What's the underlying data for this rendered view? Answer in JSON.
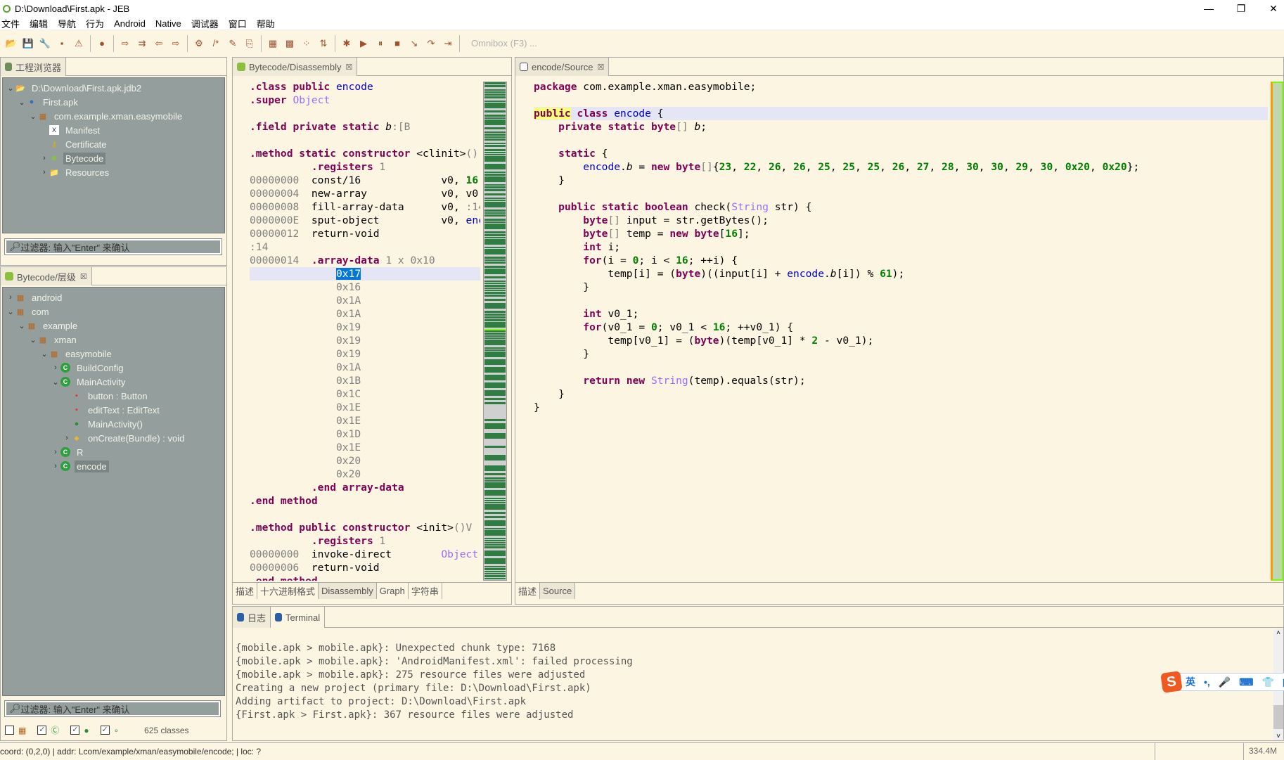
{
  "window": {
    "title": "D:\\Download\\First.apk - JEB",
    "minimize": "—",
    "restore": "❐",
    "close": "✕"
  },
  "menu": [
    "文件",
    "编辑",
    "导航",
    "行为",
    "Android",
    "Native",
    "调试器",
    "窗口",
    "帮助"
  ],
  "toolbar": {
    "icons": [
      "open-folder-icon",
      "save-icon",
      "wrench-icon",
      "stamp-icon",
      "warning-icon",
      "|",
      "globe-icon",
      "|",
      "jump-icon",
      "navigate-icon",
      "back-icon",
      "forward-icon",
      "|",
      "decompile-icon",
      "comment-icon",
      "rename-icon",
      "export-icon",
      "|",
      "package-icon",
      "classes-icon",
      "graph-icon",
      "sort-icon",
      "|",
      "debug-bug-icon",
      "run-icon",
      "pause-icon",
      "stop-icon",
      "step-into-icon",
      "step-over-icon",
      "step-out-icon",
      "|"
    ],
    "glyphs": [
      "📂",
      "💾",
      "🔧",
      "▪",
      "⚠",
      "",
      "●",
      "",
      "⇨",
      "⇉",
      "⇦",
      "⇨",
      "",
      "⚙",
      "/*",
      "✎",
      "⎘",
      "",
      "▦",
      "▩",
      "⁘",
      "⇅",
      "",
      "✱",
      "▶",
      "⏸",
      "■",
      "↘",
      "↷",
      "⇥",
      ""
    ],
    "omnibox": "Omnibox (F3) ..."
  },
  "project_explorer": {
    "tab": "工程浏览器",
    "items": [
      {
        "label": "D:\\Download\\First.apk.jdb2",
        "icon": "folder-open-icon",
        "depth": 0,
        "arrow": "v"
      },
      {
        "label": "First.apk",
        "icon": "apk-icon",
        "depth": 1,
        "arrow": "v"
      },
      {
        "label": "com.example.xman.easymobile",
        "icon": "package-icon",
        "depth": 2,
        "arrow": "v"
      },
      {
        "label": "Manifest",
        "icon": "xml-icon",
        "depth": 3,
        "arrow": ""
      },
      {
        "label": "Certificate",
        "icon": "key-icon",
        "depth": 3,
        "arrow": ""
      },
      {
        "label": "Bytecode",
        "icon": "android-icon",
        "depth": 3,
        "arrow": ">",
        "selected": true
      },
      {
        "label": "Resources",
        "icon": "folder-icon",
        "depth": 3,
        "arrow": ">"
      }
    ],
    "filter": "过滤器: 输入\"Enter\" 来确认"
  },
  "hierarchy": {
    "tab": "Bytecode/层级",
    "items": [
      {
        "label": "android",
        "icon": "package-icon",
        "depth": 0,
        "arrow": ">"
      },
      {
        "label": "com",
        "icon": "package-icon",
        "depth": 0,
        "arrow": "v"
      },
      {
        "label": "example",
        "icon": "package-icon",
        "depth": 1,
        "arrow": "v"
      },
      {
        "label": "xman",
        "icon": "package-icon",
        "depth": 2,
        "arrow": "v"
      },
      {
        "label": "easymobile",
        "icon": "package-icon",
        "depth": 3,
        "arrow": "v"
      },
      {
        "label": "BuildConfig",
        "icon": "class-icon",
        "depth": 4,
        "arrow": ">"
      },
      {
        "label": "MainActivity",
        "icon": "class-icon",
        "depth": 4,
        "arrow": "v"
      },
      {
        "label": "button : Button",
        "icon": "field-icon",
        "depth": 5,
        "arrow": ""
      },
      {
        "label": "editText : EditText",
        "icon": "field-icon",
        "depth": 5,
        "arrow": ""
      },
      {
        "label": "MainActivity()",
        "icon": "constructor-icon",
        "depth": 5,
        "arrow": ""
      },
      {
        "label": "onCreate(Bundle) : void",
        "icon": "method-icon",
        "depth": 5,
        "arrow": ">"
      },
      {
        "label": "R",
        "icon": "class-icon",
        "depth": 4,
        "arrow": ">"
      },
      {
        "label": "encode",
        "icon": "class-icon",
        "depth": 4,
        "arrow": ">",
        "selected": true
      }
    ],
    "filter": "过滤器: 输入\"Enter\" 来确认",
    "classes": "625 classes",
    "checks": [
      false,
      true,
      true,
      true
    ]
  },
  "disassembly": {
    "tab": "Bytecode/Disassembly",
    "bottom_tabs": [
      "描述",
      "十六进制格式",
      "Disassembly",
      "Graph",
      "字符串"
    ],
    "active_bottom": 2,
    "lines": [
      [
        [
          "k",
          ".class public "
        ],
        [
          "b",
          "encode"
        ]
      ],
      [
        [
          "k",
          ".super "
        ],
        [
          "o",
          "Object"
        ]
      ],
      [],
      [
        [
          "k",
          ".field private static "
        ],
        [
          "i",
          "b"
        ],
        [
          "g",
          ":[B"
        ]
      ],
      [],
      [
        [
          "k",
          ".method static constructor "
        ],
        [
          "t",
          "<clinit>"
        ],
        [
          "g",
          "()"
        ]
      ],
      [
        [
          "t",
          "          "
        ],
        [
          "k",
          ".registers "
        ],
        [
          "g",
          "1"
        ]
      ],
      [
        [
          "g",
          "00000000  "
        ],
        [
          "t",
          "const/16             v0, "
        ],
        [
          "n",
          "16"
        ]
      ],
      [
        [
          "g",
          "00000004  "
        ],
        [
          "t",
          "new-array            v0, v0,"
        ]
      ],
      [
        [
          "g",
          "00000008  "
        ],
        [
          "t",
          "fill-array-data      v0, "
        ],
        [
          "g",
          ":14"
        ]
      ],
      [
        [
          "g",
          "0000000E  "
        ],
        [
          "t",
          "sput-object          v0, "
        ],
        [
          "b",
          "encode"
        ]
      ],
      [
        [
          "g",
          "00000012  "
        ],
        [
          "t",
          "return-void"
        ]
      ],
      [
        [
          "g",
          ":14"
        ]
      ],
      [
        [
          "g",
          "00000014  "
        ],
        [
          "k",
          ".array-data "
        ],
        [
          "g",
          "1 x 0x10"
        ]
      ],
      [
        [
          "t",
          "              "
        ],
        [
          "sel",
          "0x17"
        ]
      ],
      [
        [
          "g",
          "              0x16"
        ]
      ],
      [
        [
          "g",
          "              0x1A"
        ]
      ],
      [
        [
          "g",
          "              0x1A"
        ]
      ],
      [
        [
          "g",
          "              0x19"
        ]
      ],
      [
        [
          "g",
          "              0x19"
        ]
      ],
      [
        [
          "g",
          "              0x19"
        ]
      ],
      [
        [
          "g",
          "              0x1A"
        ]
      ],
      [
        [
          "g",
          "              0x1B"
        ]
      ],
      [
        [
          "g",
          "              0x1C"
        ]
      ],
      [
        [
          "g",
          "              0x1E"
        ]
      ],
      [
        [
          "g",
          "              0x1E"
        ]
      ],
      [
        [
          "g",
          "              0x1D"
        ]
      ],
      [
        [
          "g",
          "              0x1E"
        ]
      ],
      [
        [
          "g",
          "              0x20"
        ]
      ],
      [
        [
          "g",
          "              0x20"
        ]
      ],
      [
        [
          "t",
          "          "
        ],
        [
          "k",
          ".end array-data"
        ]
      ],
      [
        [
          "k",
          ".end method"
        ]
      ],
      [],
      [
        [
          "k",
          ".method public constructor "
        ],
        [
          "t",
          "<init>"
        ],
        [
          "g",
          "()V"
        ]
      ],
      [
        [
          "t",
          "          "
        ],
        [
          "k",
          ".registers "
        ],
        [
          "g",
          "1"
        ]
      ],
      [
        [
          "g",
          "00000000  "
        ],
        [
          "t",
          "invoke-direct        "
        ],
        [
          "o",
          "Object-"
        ]
      ],
      [
        [
          "g",
          "00000006  "
        ],
        [
          "t",
          "return-void"
        ]
      ],
      [
        [
          "k",
          ".end method"
        ]
      ]
    ]
  },
  "source": {
    "tab": "encode/Source",
    "bottom_tabs": [
      "描述",
      "Source"
    ],
    "active_bottom": 1,
    "lines": [
      [
        [
          "k",
          "package "
        ],
        [
          "t",
          "com.example.xman.easymobile;"
        ]
      ],
      [],
      [
        [
          "hl",
          "public"
        ],
        [
          "k",
          " class "
        ],
        [
          "b",
          "encode"
        ],
        [
          "t",
          " {"
        ]
      ],
      [
        [
          "t",
          "    "
        ],
        [
          "k",
          "private static byte"
        ],
        [
          "g",
          "[]"
        ],
        [
          "t",
          " "
        ],
        [
          "i",
          "b"
        ],
        [
          "t",
          ";"
        ]
      ],
      [],
      [
        [
          "t",
          "    "
        ],
        [
          "k",
          "static"
        ],
        [
          "t",
          " {"
        ]
      ],
      [
        [
          "t",
          "        "
        ],
        [
          "b",
          "encode"
        ],
        [
          "t",
          "."
        ],
        [
          "i",
          "b"
        ],
        [
          "t",
          " = "
        ],
        [
          "k",
          "new byte"
        ],
        [
          "g",
          "[]"
        ],
        [
          "t",
          "{"
        ],
        [
          "n",
          "23"
        ],
        [
          "t",
          ", "
        ],
        [
          "n",
          "22"
        ],
        [
          "t",
          ", "
        ],
        [
          "n",
          "26"
        ],
        [
          "t",
          ", "
        ],
        [
          "n",
          "26"
        ],
        [
          "t",
          ", "
        ],
        [
          "n",
          "25"
        ],
        [
          "t",
          ", "
        ],
        [
          "n",
          "25"
        ],
        [
          "t",
          ", "
        ],
        [
          "n",
          "25"
        ],
        [
          "t",
          ", "
        ],
        [
          "n",
          "26"
        ],
        [
          "t",
          ", "
        ],
        [
          "n",
          "27"
        ],
        [
          "t",
          ", "
        ],
        [
          "n",
          "28"
        ],
        [
          "t",
          ", "
        ],
        [
          "n",
          "30"
        ],
        [
          "t",
          ", "
        ],
        [
          "n",
          "30"
        ],
        [
          "t",
          ", "
        ],
        [
          "n",
          "29"
        ],
        [
          "t",
          ", "
        ],
        [
          "n",
          "30"
        ],
        [
          "t",
          ", "
        ],
        [
          "n",
          "0x20"
        ],
        [
          "t",
          ", "
        ],
        [
          "n",
          "0x20"
        ],
        [
          "t",
          "};"
        ]
      ],
      [
        [
          "t",
          "    }"
        ]
      ],
      [],
      [
        [
          "t",
          "    "
        ],
        [
          "k",
          "public static boolean"
        ],
        [
          "t",
          " check("
        ],
        [
          "o",
          "String"
        ],
        [
          "t",
          " str) {"
        ]
      ],
      [
        [
          "t",
          "        "
        ],
        [
          "k",
          "byte"
        ],
        [
          "g",
          "[]"
        ],
        [
          "t",
          " input = str.getBytes();"
        ]
      ],
      [
        [
          "t",
          "        "
        ],
        [
          "k",
          "byte"
        ],
        [
          "g",
          "[]"
        ],
        [
          "t",
          " temp = "
        ],
        [
          "k",
          "new byte"
        ],
        [
          "t",
          "["
        ],
        [
          "n",
          "16"
        ],
        [
          "t",
          "];"
        ]
      ],
      [
        [
          "t",
          "        "
        ],
        [
          "k",
          "int"
        ],
        [
          "t",
          " i;"
        ]
      ],
      [
        [
          "t",
          "        "
        ],
        [
          "k",
          "for"
        ],
        [
          "t",
          "(i = "
        ],
        [
          "n",
          "0"
        ],
        [
          "t",
          "; i < "
        ],
        [
          "n",
          "16"
        ],
        [
          "t",
          "; ++i) {"
        ]
      ],
      [
        [
          "t",
          "            temp[i] = ("
        ],
        [
          "k",
          "byte"
        ],
        [
          "t",
          ")((input[i] + "
        ],
        [
          "b",
          "encode"
        ],
        [
          "t",
          "."
        ],
        [
          "i",
          "b"
        ],
        [
          "t",
          "[i]) % "
        ],
        [
          "n",
          "61"
        ],
        [
          "t",
          ");"
        ]
      ],
      [
        [
          "t",
          "        }"
        ]
      ],
      [],
      [
        [
          "t",
          "        "
        ],
        [
          "k",
          "int"
        ],
        [
          "t",
          " v0_1;"
        ]
      ],
      [
        [
          "t",
          "        "
        ],
        [
          "k",
          "for"
        ],
        [
          "t",
          "(v0_1 = "
        ],
        [
          "n",
          "0"
        ],
        [
          "t",
          "; v0_1 < "
        ],
        [
          "n",
          "16"
        ],
        [
          "t",
          "; ++v0_1) {"
        ]
      ],
      [
        [
          "t",
          "            temp[v0_1] = ("
        ],
        [
          "k",
          "byte"
        ],
        [
          "t",
          ")(temp[v0_1] * "
        ],
        [
          "n",
          "2"
        ],
        [
          "t",
          " - v0_1);"
        ]
      ],
      [
        [
          "t",
          "        }"
        ]
      ],
      [],
      [
        [
          "t",
          "        "
        ],
        [
          "k",
          "return new "
        ],
        [
          "o",
          "String"
        ],
        [
          "t",
          "(temp).equals(str);"
        ]
      ],
      [
        [
          "t",
          "    }"
        ]
      ],
      [
        [
          "t",
          "}"
        ]
      ]
    ]
  },
  "console": {
    "tabs": [
      "日志",
      "Terminal"
    ],
    "lines": [
      "{mobile.apk > mobile.apk}: Unexpected chunk type: 7168",
      "{mobile.apk > mobile.apk}: 'AndroidManifest.xml': failed processing",
      "{mobile.apk > mobile.apk}: 275 resource files were adjusted",
      "Creating a new project (primary file: D:\\Download\\First.apk)",
      "Adding artifact to project: D:\\Download\\First.apk",
      "{First.apk > First.apk}: 367 resource files were adjusted"
    ]
  },
  "ime": {
    "logo": "S",
    "items": [
      "英",
      "•,",
      "🎤",
      "⌨",
      "👕",
      "▦"
    ]
  },
  "statusbar": {
    "text": "coord: (0,2,0) | addr: Lcom/example/xman/easymobile/encode; | loc: ?",
    "memory": "334.4M"
  },
  "colors": {
    "background": "#fcf5e2",
    "tree": "#949f9d",
    "keyword": "#7f0055",
    "number": "#008000",
    "type": "#9a6cff",
    "selection": "#0078d7"
  }
}
